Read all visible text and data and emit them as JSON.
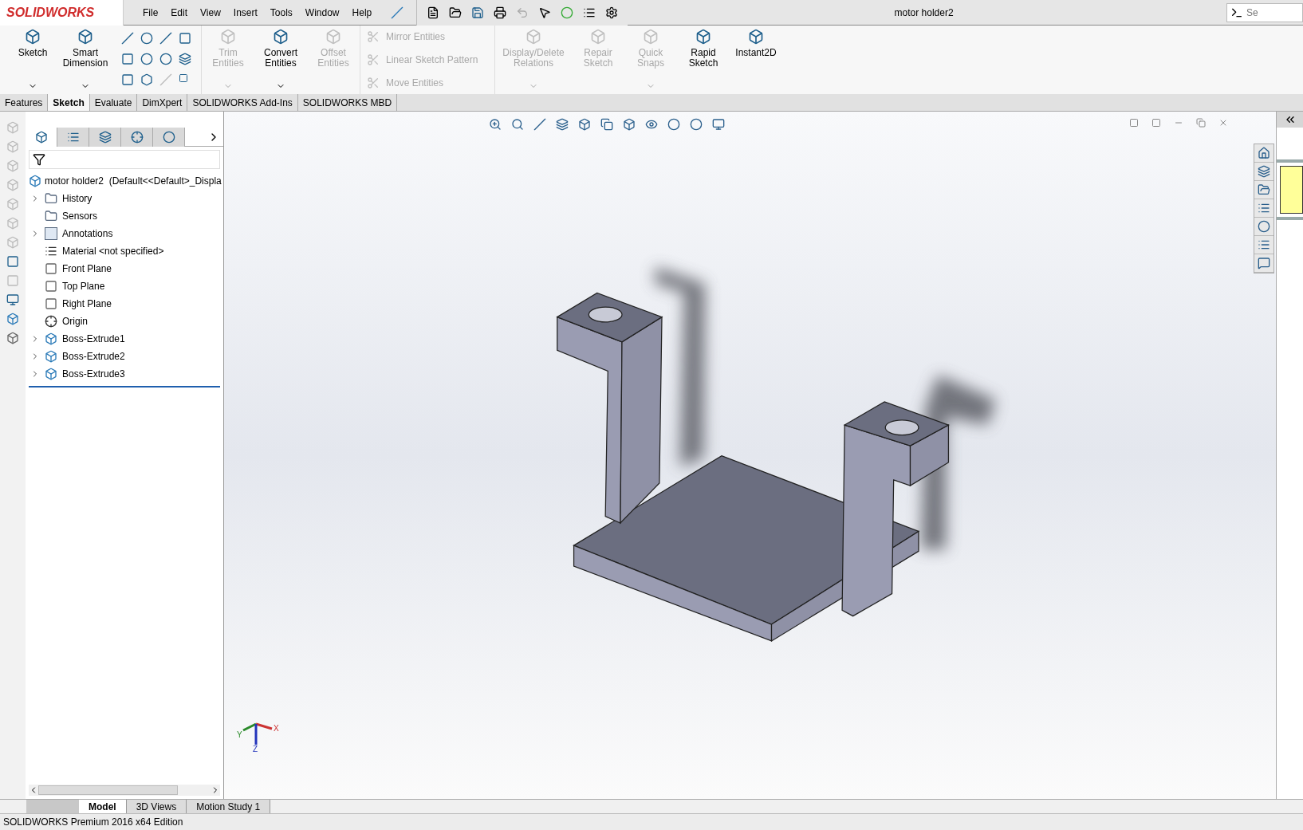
{
  "logo": {
    "text": "SOLIDWORKS"
  },
  "menu": [
    "File",
    "Edit",
    "View",
    "Insert",
    "Tools",
    "Window",
    "Help"
  ],
  "window": {
    "title": "motor holder2"
  },
  "search": {
    "placeholder": "Se"
  },
  "ribbon": [
    {
      "kind": "big",
      "label": "Sketch",
      "disabled": false,
      "dropdown": true
    },
    {
      "kind": "big",
      "label": "Smart Dimension",
      "disabled": false,
      "dropdown": true
    },
    {
      "kind": "tools"
    },
    {
      "kind": "big",
      "label": "Trim Entities",
      "disabled": true,
      "dropdown": true
    },
    {
      "kind": "big",
      "label": "Convert Entities",
      "disabled": false,
      "dropdown": true
    },
    {
      "kind": "big",
      "label": "Offset Entities",
      "disabled": true,
      "dropdown": false
    },
    {
      "kind": "list",
      "items": [
        {
          "label": "Mirror Entities",
          "disabled": true
        },
        {
          "label": "Linear Sketch Pattern",
          "disabled": true
        },
        {
          "label": "Move Entities",
          "disabled": true
        }
      ]
    },
    {
      "kind": "big",
      "label": "Display/Delete Relations",
      "disabled": true,
      "dropdown": true
    },
    {
      "kind": "big",
      "label": "Repair Sketch",
      "disabled": true,
      "dropdown": false
    },
    {
      "kind": "big",
      "label": "Quick Snaps",
      "disabled": true,
      "dropdown": true
    },
    {
      "kind": "big",
      "label": "Rapid Sketch",
      "disabled": false,
      "dropdown": false
    },
    {
      "kind": "big",
      "label": "Instant2D",
      "disabled": false,
      "dropdown": false
    }
  ],
  "command_tabs": [
    {
      "label": "Features",
      "selected": false
    },
    {
      "label": "Sketch",
      "selected": true
    },
    {
      "label": "Evaluate",
      "selected": false
    },
    {
      "label": "DimXpert",
      "selected": false
    },
    {
      "label": "SOLIDWORKS Add-Ins",
      "selected": false
    },
    {
      "label": "SOLIDWORKS MBD",
      "selected": false
    }
  ],
  "panel_tabs": [
    {
      "selected": true
    },
    {
      "selected": false
    },
    {
      "selected": false
    },
    {
      "selected": false
    },
    {
      "selected": false
    }
  ],
  "tree": {
    "root": "motor holder2  (Default<<Default>_Displa",
    "items": [
      {
        "label": "History",
        "kind": "folder",
        "expandable": true
      },
      {
        "label": "Sensors",
        "kind": "folder",
        "expandable": false
      },
      {
        "label": "Annotations",
        "kind": "annotation",
        "expandable": true
      },
      {
        "label": "Material <not specified>",
        "kind": "material",
        "expandable": false
      },
      {
        "label": "Front Plane",
        "kind": "plane",
        "expandable": false
      },
      {
        "label": "Top Plane",
        "kind": "plane",
        "expandable": false
      },
      {
        "label": "Right Plane",
        "kind": "plane",
        "expandable": false
      },
      {
        "label": "Origin",
        "kind": "origin",
        "expandable": false
      },
      {
        "label": "Boss-Extrude1",
        "kind": "feature",
        "expandable": true
      },
      {
        "label": "Boss-Extrude2",
        "kind": "feature",
        "expandable": true
      },
      {
        "label": "Boss-Extrude3",
        "kind": "feature",
        "expandable": true
      }
    ]
  },
  "axes": {
    "x": "X",
    "y": "Y",
    "z": "Z"
  },
  "bottom_tabs": [
    {
      "label": "Model",
      "selected": true
    },
    {
      "label": "3D Views",
      "selected": false
    },
    {
      "label": "Motion Study 1",
      "selected": false
    }
  ],
  "status_bar": "SOLIDWORKS Premium 2016 x64 Edition"
}
